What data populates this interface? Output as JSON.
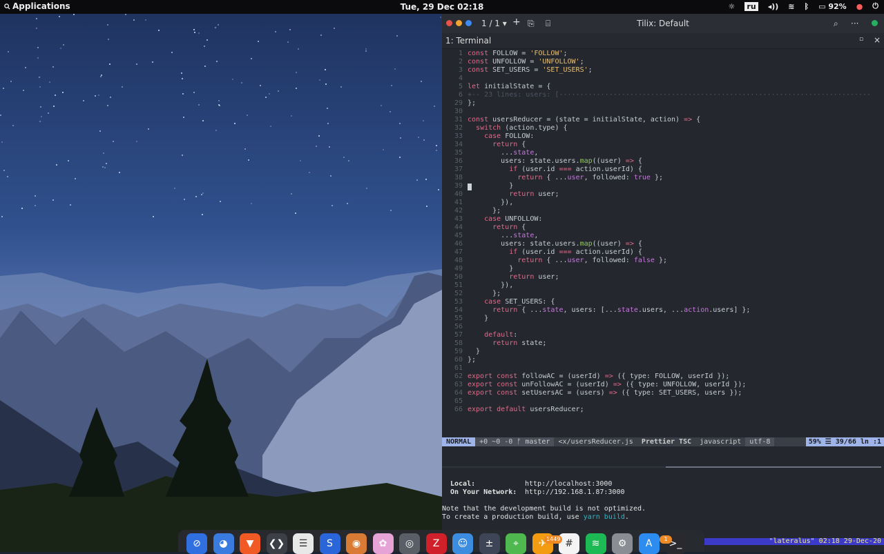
{
  "topbar": {
    "applications_label": "Applications",
    "clock": "Tue, 29 Dec  02:18",
    "keyboard_layout": "ru",
    "battery": "92%",
    "icons": [
      "brightness-icon",
      "volume-icon",
      "wifi-icon",
      "bluetooth-icon",
      "battery-icon",
      "notification-icon",
      "power-icon"
    ]
  },
  "window": {
    "tab_counter": "1 / 1",
    "title": "Tilix: Default",
    "terminal_tab": "1: Terminal",
    "colors": {
      "close": "#e5534b",
      "minimize": "#f0a330",
      "maximize": "#3d8bf0",
      "status": "#27ae60"
    }
  },
  "editor": {
    "cursor_line_number": "39",
    "lines": [
      {
        "n": "1",
        "t": "const FOLLOW = 'FOLLOW';"
      },
      {
        "n": "2",
        "t": "const UNFOLLOW = 'UNFOLLOW';"
      },
      {
        "n": "3",
        "t": "const SET_USERS = 'SET_USERS';"
      },
      {
        "n": "4",
        "t": ""
      },
      {
        "n": "5",
        "t": "let initialState = {"
      },
      {
        "n": "6",
        "t": "+-- 23 lines: users: [···········································································",
        "fold": true
      },
      {
        "n": "29",
        "t": "};"
      },
      {
        "n": "30",
        "t": ""
      },
      {
        "n": "31",
        "t": "const usersReducer = (state = initialState, action) => {"
      },
      {
        "n": "32",
        "t": "  switch (action.type) {"
      },
      {
        "n": "33",
        "t": "    case FOLLOW:"
      },
      {
        "n": "34",
        "t": "      return {"
      },
      {
        "n": "35",
        "t": "        ...state,"
      },
      {
        "n": "36",
        "t": "        users: state.users.map((user) => {"
      },
      {
        "n": "37",
        "t": "          if (user.id === action.userId) {"
      },
      {
        "n": "38",
        "t": "            return { ...user, followed: true };"
      },
      {
        "n": "39",
        "t": "          }"
      },
      {
        "n": "40",
        "t": "          return user;"
      },
      {
        "n": "41",
        "t": "        }),"
      },
      {
        "n": "42",
        "t": "      };"
      },
      {
        "n": "43",
        "t": "    case UNFOLLOW:"
      },
      {
        "n": "44",
        "t": "      return {"
      },
      {
        "n": "45",
        "t": "        ...state,"
      },
      {
        "n": "46",
        "t": "        users: state.users.map((user) => {"
      },
      {
        "n": "47",
        "t": "          if (user.id === action.userId) {"
      },
      {
        "n": "48",
        "t": "            return { ...user, followed: false };"
      },
      {
        "n": "49",
        "t": "          }"
      },
      {
        "n": "50",
        "t": "          return user;"
      },
      {
        "n": "51",
        "t": "        }),"
      },
      {
        "n": "52",
        "t": "      };"
      },
      {
        "n": "53",
        "t": "    case SET_USERS: {"
      },
      {
        "n": "54",
        "t": "      return { ...state, users: [...state.users, ...action.users] };"
      },
      {
        "n": "55",
        "t": "    }"
      },
      {
        "n": "56",
        "t": ""
      },
      {
        "n": "57",
        "t": "    default:"
      },
      {
        "n": "58",
        "t": "      return state;"
      },
      {
        "n": "59",
        "t": "  }"
      },
      {
        "n": "60",
        "t": "};"
      },
      {
        "n": "61",
        "t": ""
      },
      {
        "n": "62",
        "t": "export const followAC = (userId) => ({ type: FOLLOW, userId });"
      },
      {
        "n": "63",
        "t": "export const unFollowAC = (userId) => ({ type: UNFOLLOW, userId });"
      },
      {
        "n": "64",
        "t": "export const setUsersAC = (users) => ({ type: SET_USERS, users });"
      },
      {
        "n": "65",
        "t": ""
      },
      {
        "n": "66",
        "t": "export default usersReducer;"
      }
    ]
  },
  "statusline": {
    "mode": "NORMAL",
    "git": "+0 ~0 -0 ᚠ master",
    "file": "<x/usersReducer.js",
    "linters": "Prettier TSC",
    "filetype": "javascript",
    "encoding": "utf-8",
    "position": "59% ☰ 39/66 ln :1"
  },
  "output": {
    "local_label": "Local:",
    "local_url": "http://localhost:3000",
    "network_label": "On Your Network:",
    "network_url": "http://192.168.1.87:3000",
    "note1": "Note that the development build is not optimized.",
    "note2_prefix": "To create a production build, use ",
    "note2_cmd": "yarn build",
    "note2_suffix": "."
  },
  "tmux": {
    "status": "\"lateralus\" 02:18 29-Dec-20"
  },
  "dock": {
    "badge_1": "1449",
    "badge_2": "1",
    "items": [
      {
        "name": "safari-icon",
        "color": "#2f6fe0"
      },
      {
        "name": "firefox-icon",
        "color": "#3a7be0"
      },
      {
        "name": "brave-icon",
        "color": "#f15a24"
      },
      {
        "name": "vscode-icon",
        "color": "#3c3f46"
      },
      {
        "name": "notes-icon",
        "color": "#e8e8e8"
      },
      {
        "name": "simplenote-icon",
        "color": "#2a66d9"
      },
      {
        "name": "gimp-icon",
        "color": "#d97b35"
      },
      {
        "name": "photos-icon",
        "color": "#e6a3d6"
      },
      {
        "name": "screenshot-icon",
        "color": "#5a5e66"
      },
      {
        "name": "filezilla-icon",
        "color": "#d0202a"
      },
      {
        "name": "finder-icon",
        "color": "#3c8de0"
      },
      {
        "name": "calculator-icon",
        "color": "#3d4556"
      },
      {
        "name": "maps-icon",
        "color": "#4fb84f"
      },
      {
        "name": "flights-icon",
        "color": "#f39c12"
      },
      {
        "name": "slack-icon",
        "color": "#f4f4f4"
      },
      {
        "name": "spotify-icon",
        "color": "#1db954"
      },
      {
        "name": "settings-icon",
        "color": "#8a8d93"
      },
      {
        "name": "appstore-icon",
        "color": "#2d8cf0"
      },
      {
        "name": "terminal-icon",
        "color": "#2a2a2e"
      }
    ]
  }
}
